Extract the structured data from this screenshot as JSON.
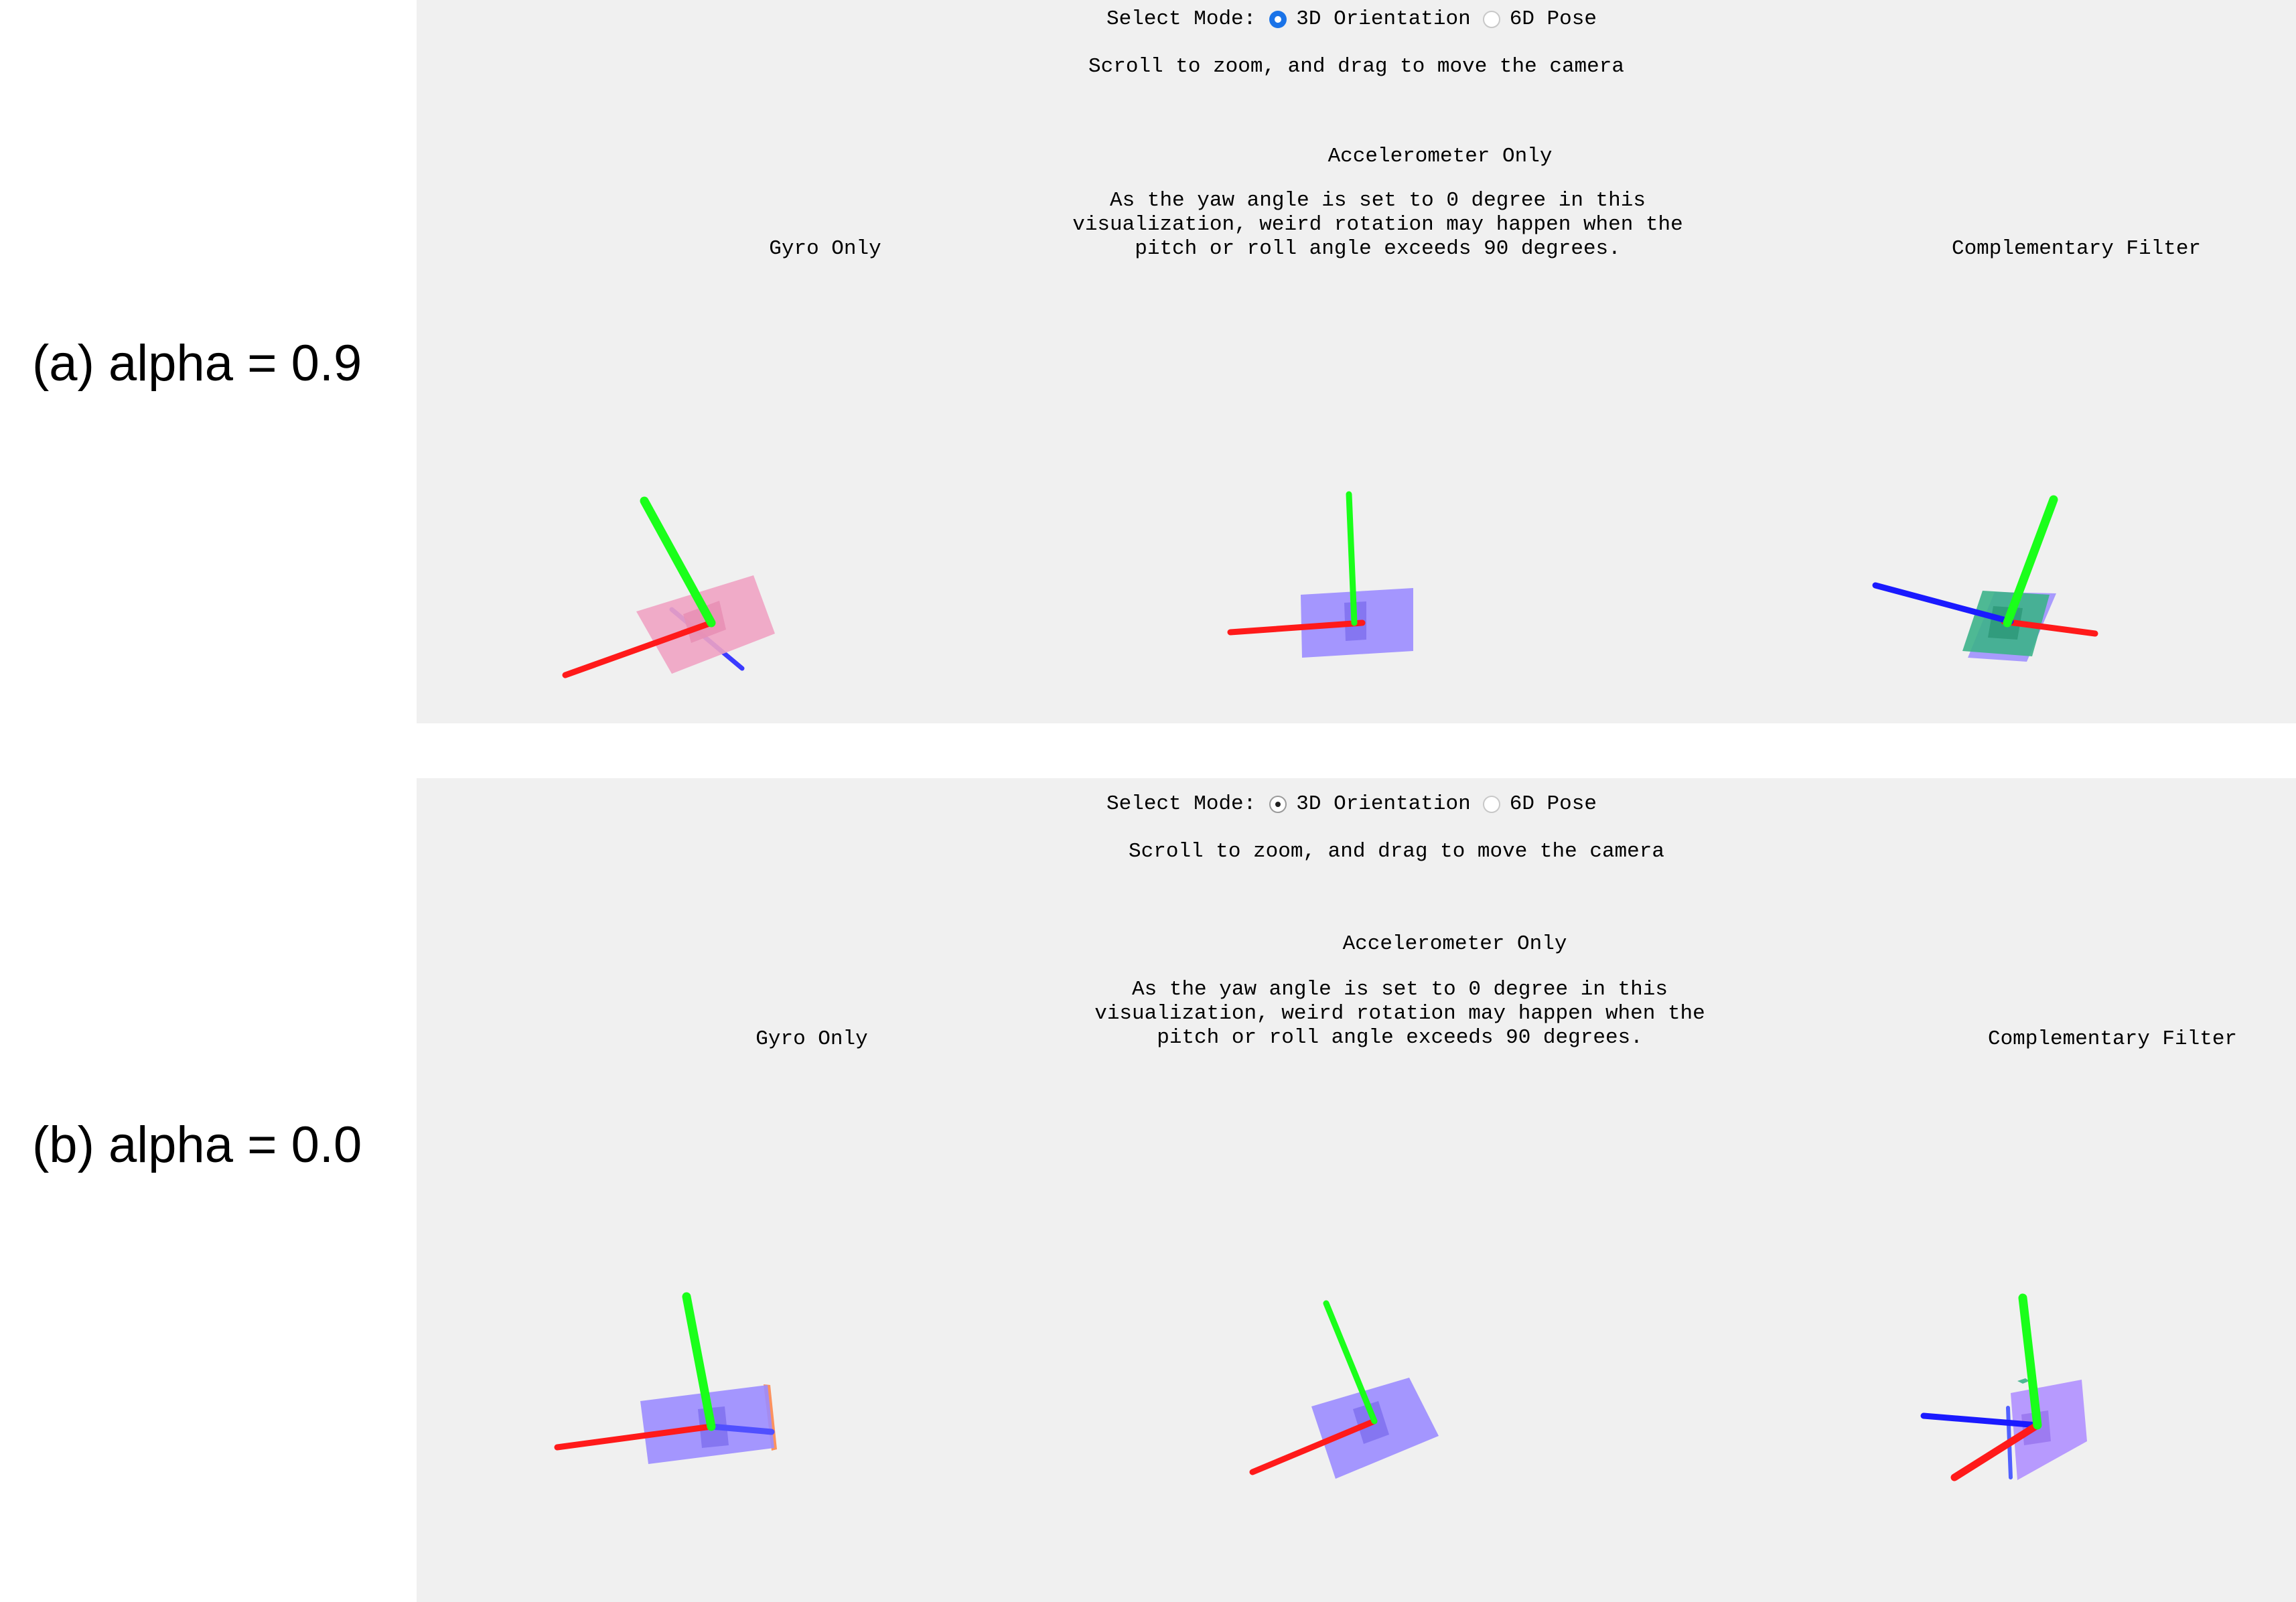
{
  "rows": [
    {
      "label": "(a) alpha = 0.9",
      "mode": {
        "prompt": "Select Mode:",
        "options": [
          {
            "label": "3D Orientation",
            "checked": true
          },
          {
            "label": "6D Pose",
            "checked": false
          }
        ]
      },
      "hint": "Scroll to zoom, and drag to move the camera",
      "views": {
        "gyro": {
          "title": "Gyro Only"
        },
        "accel": {
          "title": "Accelerometer Only",
          "note": "As the yaw angle is set to 0 degree in this visualization, weird rotation may happen when the pitch or roll angle exceeds 90 degrees."
        },
        "comp": {
          "title": "Complementary Filter"
        }
      }
    },
    {
      "label": "(b) alpha = 0.0",
      "mode": {
        "prompt": "Select Mode:",
        "options": [
          {
            "label": "3D Orientation",
            "checked": true
          },
          {
            "label": "6D Pose",
            "checked": false
          }
        ]
      },
      "hint": "Scroll to zoom, and drag to move the camera",
      "views": {
        "gyro": {
          "title": "Gyro Only"
        },
        "accel": {
          "title": "Accelerometer Only",
          "note": "As the yaw angle is set to 0 degree in this visualization, weird rotation may happen when the pitch or roll angle exceeds 90 degrees."
        },
        "comp": {
          "title": "Complementary Filter"
        }
      }
    }
  ],
  "colors": {
    "x_axis": "#ff1a1a",
    "y_axis": "#1aff1a",
    "z_axis": "#1a1aff",
    "box_violet": "#9b8cff",
    "box_pink": "#f0a3c3",
    "box_green": "#3cb38a",
    "panel_bg": "#f0f0f0",
    "radio_blue": "#1a73e8"
  }
}
